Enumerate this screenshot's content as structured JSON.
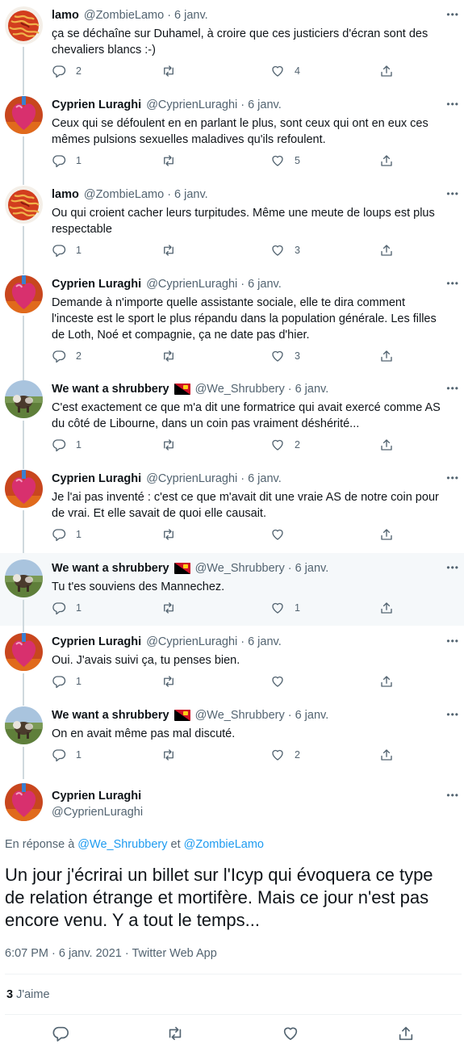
{
  "tweets": [
    {
      "name": "lamo",
      "handle": "@ZombieLamo",
      "date": "6 janv.",
      "text": "ça se déchaîne sur Duhamel, à croire que ces justiciers d'écran sont des chevaliers blancs :-)",
      "replies": "2",
      "retweets": "",
      "likes": "4",
      "avatar": "spaghetti"
    },
    {
      "name": "Cyprien Luraghi",
      "handle": "@CyprienLuraghi",
      "date": "6 janv.",
      "text": "Ceux qui se défoulent en en parlant le plus, sont ceux qui ont en eux ces mêmes pulsions sexuelles maladives qu'ils refoulent.",
      "replies": "1",
      "retweets": "",
      "likes": "5",
      "avatar": "heart"
    },
    {
      "name": "lamo",
      "handle": "@ZombieLamo",
      "date": "6 janv.",
      "text": "Ou qui croient cacher leurs turpitudes. Même une meute de loups est plus respectable",
      "replies": "1",
      "retweets": "",
      "likes": "3",
      "avatar": "spaghetti"
    },
    {
      "name": "Cyprien Luraghi",
      "handle": "@CyprienLuraghi",
      "date": "6 janv.",
      "text": "Demande à n'importe quelle assistante sociale, elle te dira comment l'inceste est le sport le plus répandu dans la population générale. Les filles de Loth, Noé et compagnie, ça ne date pas d'hier.",
      "replies": "2",
      "retweets": "",
      "likes": "3",
      "avatar": "heart"
    },
    {
      "name": "We want a shrubbery",
      "handle": "@We_Shrubbery",
      "date": "6 janv.",
      "text": "C'est exactement ce que m'a dit une formatrice qui avait exercé comme AS du côté de Libourne, dans un coin pas vraiment déshérité...",
      "replies": "1",
      "retweets": "",
      "likes": "2",
      "avatar": "cow",
      "flag": true
    },
    {
      "name": "Cyprien Luraghi",
      "handle": "@CyprienLuraghi",
      "date": "6 janv.",
      "text": "Je l'ai pas inventé : c'est ce que m'avait dit une vraie AS de notre coin pour de vrai. Et elle savait de quoi elle causait.",
      "replies": "1",
      "retweets": "",
      "likes": "",
      "avatar": "heart"
    },
    {
      "name": "We want a shrubbery",
      "handle": "@We_Shrubbery",
      "date": "6 janv.",
      "text": "Tu t'es souviens des Mannechez.",
      "replies": "1",
      "retweets": "",
      "likes": "1",
      "avatar": "cow",
      "flag": true
    },
    {
      "name": "Cyprien Luraghi",
      "handle": "@CyprienLuraghi",
      "date": "6 janv.",
      "text": "Oui. J'avais suivi ça, tu penses bien.",
      "replies": "1",
      "retweets": "",
      "likes": "",
      "avatar": "heart"
    },
    {
      "name": "We want a shrubbery",
      "handle": "@We_Shrubbery",
      "date": "6 janv.",
      "text": "On en avait même pas mal discuté.",
      "replies": "1",
      "retweets": "",
      "likes": "2",
      "avatar": "cow",
      "flag": true
    }
  ],
  "main": {
    "name": "Cyprien Luraghi",
    "handle": "@CyprienLuraghi",
    "reply_prefix": "En réponse à",
    "reply_user1": "@We_Shrubbery",
    "reply_and": "et",
    "reply_user2": "@ZombieLamo",
    "text": "Un jour j'écrirai un billet sur l'Icyp qui évoquera ce type de relation étrange et mortifère. Mais ce jour n'est pas encore venu. Y a tout le temps...",
    "time": "6:07 PM",
    "date": "6 janv. 2021",
    "source": "Twitter Web App",
    "likes_count": "3",
    "likes_label": "J'aime"
  },
  "colors": {
    "accent": "#1d9bf0",
    "text": "#0f1419",
    "muted": "#536471",
    "highlight_bg": "#f5f8fa"
  }
}
